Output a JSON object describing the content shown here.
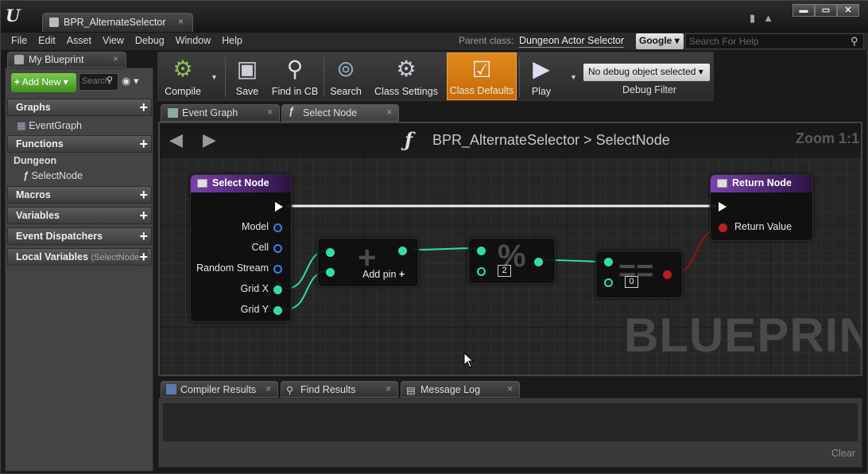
{
  "window": {
    "tab_title": "BPR_AlternateSelector",
    "tab_close": "×",
    "controls": [
      "▬",
      "▭",
      "✕"
    ]
  },
  "menu": {
    "items": [
      "File",
      "Edit",
      "Asset",
      "View",
      "Debug",
      "Window",
      "Help"
    ],
    "parent_class_label": "Parent class:",
    "parent_class_value": "Dungeon Actor Selector",
    "search_provider": "Google",
    "help_search_placeholder": "Search For Help"
  },
  "my_blueprint": {
    "tab_label": "My Blueprint",
    "add_new": "Add New",
    "search_placeholder": "Search",
    "sections": {
      "graphs": "Graphs",
      "graphs_item": "EventGraph",
      "functions": "Functions",
      "dungeon_category": "Dungeon",
      "function_item": "SelectNode",
      "macros": "Macros",
      "variables": "Variables",
      "event_dispatchers": "Event Dispatchers",
      "local_variables": "Local Variables",
      "local_variables_sub": "(SelectNode)"
    }
  },
  "toolbar": {
    "compile": "Compile",
    "save": "Save",
    "find_in_cb": "Find in CB",
    "search": "Search",
    "class_settings": "Class Settings",
    "class_defaults": "Class Defaults",
    "play": "Play",
    "debug_object": "No debug object selected",
    "debug_filter": "Debug Filter"
  },
  "graph_tabs": [
    "Event Graph",
    "Select Node"
  ],
  "graph": {
    "breadcrumb_root": "BPR_AlternateSelector",
    "breadcrumb_sep": ">",
    "breadcrumb_leaf": "SelectNode",
    "zoom": "Zoom 1:1",
    "watermark": "BLUEPRINT",
    "entry_node": {
      "title": "Select Node",
      "pins": [
        "Model",
        "Cell",
        "Random Stream",
        "Grid X",
        "Grid Y"
      ]
    },
    "add_node": {
      "add_pin_label": "Add pin",
      "symbol": "+"
    },
    "mod_node": {
      "symbol": "%",
      "literal": "2"
    },
    "eq_node": {
      "symbol": "==",
      "literal": "0"
    },
    "return_node": {
      "title": "Return Node",
      "pin": "Return Value"
    }
  },
  "bottom_tabs": [
    "Compiler Results",
    "Find Results",
    "Message Log"
  ],
  "bottom": {
    "clear": "Clear"
  },
  "colors": {
    "accent_orange": "#d97a0f",
    "pin_int": "#2fe0a4",
    "pin_bool": "#c51b1b",
    "pin_object": "#3c7de8",
    "node_header": "#7a3fb0",
    "add_new_green": "#5fb33a"
  }
}
